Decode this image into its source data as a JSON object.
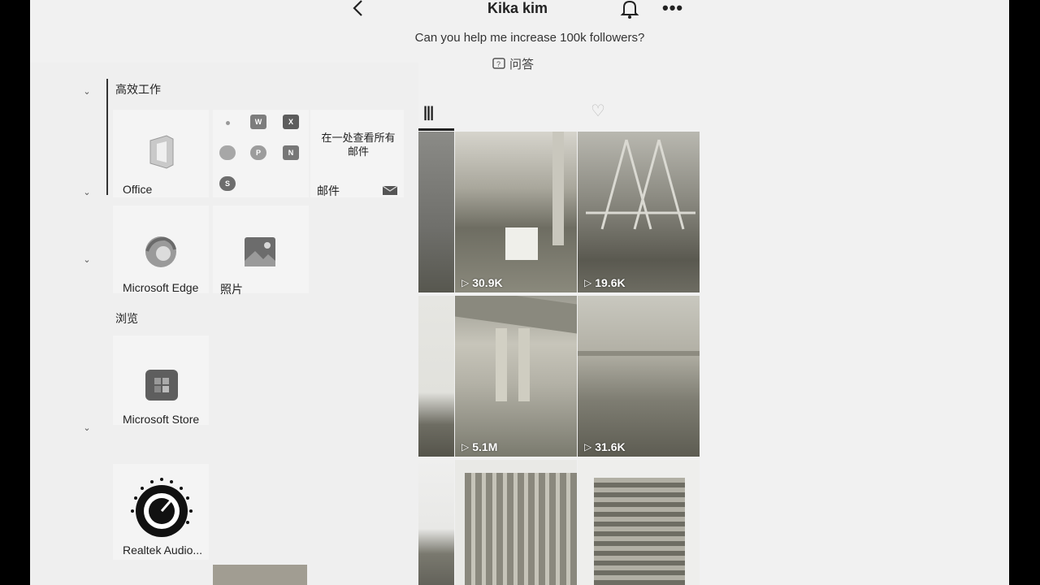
{
  "header": {
    "back_icon": "back-chevron-icon",
    "title": "Kika kim",
    "bell_icon": "bell-icon",
    "more_icon": "more-dots-icon",
    "bio": "Can you help me increase 100k followers?",
    "qa_label": "问答"
  },
  "start_menu": {
    "groups": [
      {
        "label": "高效工作"
      },
      {
        "label": "浏览"
      }
    ],
    "tiles": {
      "office": "Office",
      "mail_promo": "在一处查看所有邮件",
      "mail": "邮件",
      "edge": "Microsoft Edge",
      "photos": "照片",
      "store": "Microsoft Store",
      "realtek": "Realtek Audio..."
    },
    "mini_apps": [
      "W",
      "X",
      "P",
      "N",
      "S"
    ]
  },
  "grid": {
    "tab_videos_icon": "grid-icon",
    "tab_liked_icon": "heart-icon",
    "videos": [
      {
        "views": "30.9K"
      },
      {
        "views": "19.6K"
      },
      {
        "views": "5.1M"
      },
      {
        "views": "31.6K"
      }
    ]
  },
  "colors": {
    "accent": "#222222",
    "background": "#f1f1f1",
    "office": "#d4573a",
    "edge": "#3a8fd6"
  }
}
